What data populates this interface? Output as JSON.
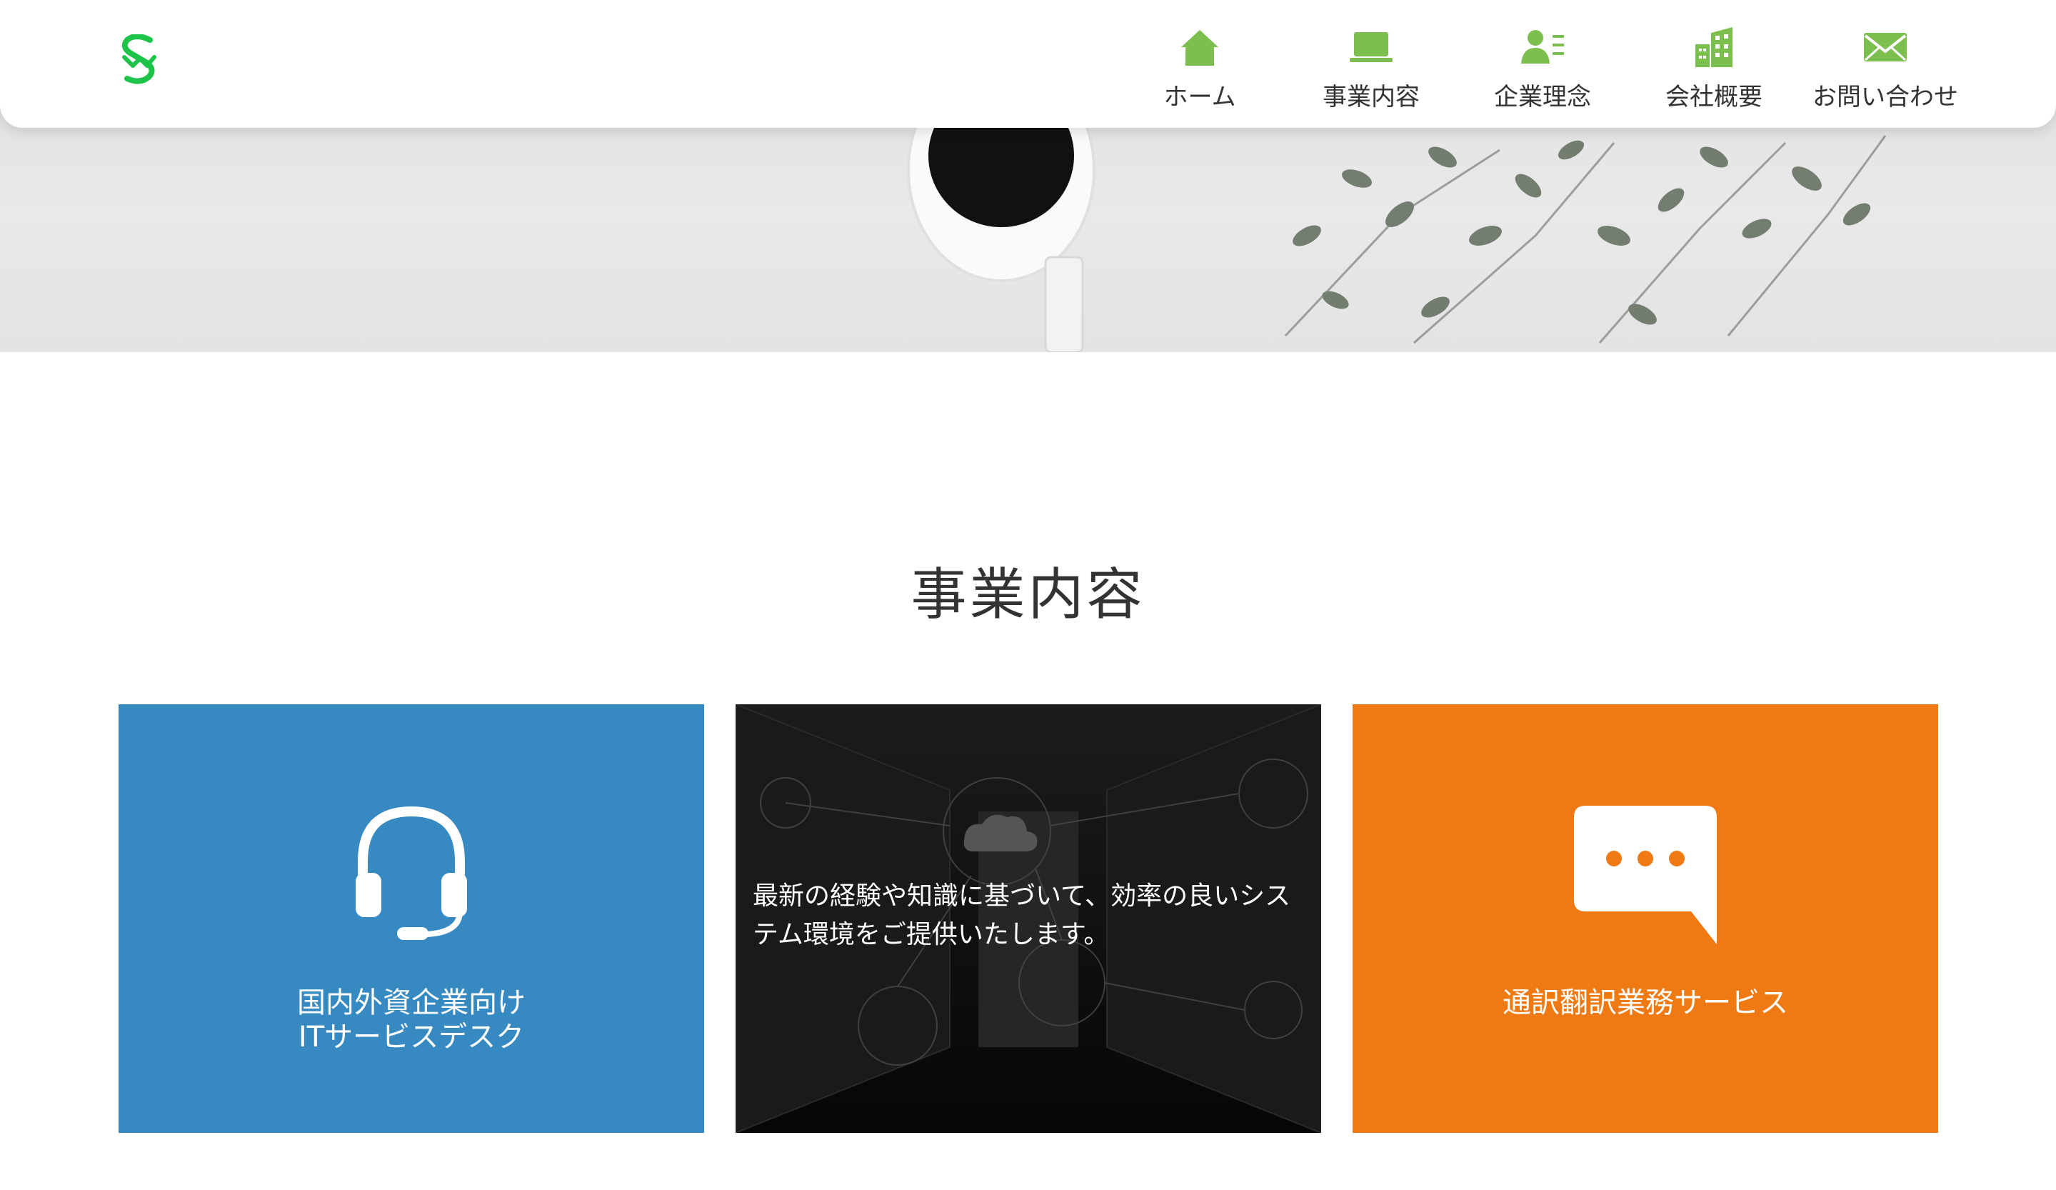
{
  "header": {
    "logo": {
      "icon": "sm-logo-icon",
      "color": "#1ec34a"
    },
    "nav": [
      {
        "label": "ホーム",
        "icon": "home-icon"
      },
      {
        "label": "事業内容",
        "icon": "laptop-icon"
      },
      {
        "label": "企業理念",
        "icon": "profile-card-icon"
      },
      {
        "label": "会社概要",
        "icon": "building-icon"
      },
      {
        "label": "お問い合わせ",
        "icon": "mail-icon"
      }
    ],
    "nav_icon_color": "#7cbf4f"
  },
  "section": {
    "title": "事業内容",
    "cards": [
      {
        "title_line1": "国内外資企業向け",
        "title_line2": "ITサービスデスク",
        "icon": "headset-icon",
        "color": "#378ac1"
      },
      {
        "description": "最新の経験や知識に基づいて、効率の良いシステム環境をご提供いたします。",
        "background": "server-room-image",
        "color": "#0d0d0d"
      },
      {
        "title_line1": "通訳翻訳業務サービス",
        "icon": "speech-bubble-icon",
        "color": "#ef7a13"
      }
    ]
  }
}
